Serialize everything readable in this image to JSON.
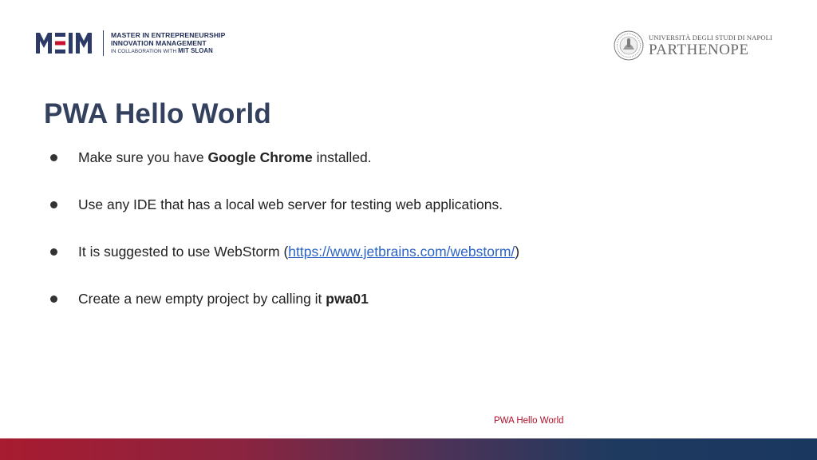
{
  "header": {
    "left_logo": {
      "mark_text": "MEIM",
      "line1": "MASTER IN ENTREPRENEURSHIP",
      "line2": "INNOVATION MANAGEMENT",
      "line3_prefix": "IN COLLABORATION WITH ",
      "line3_strong": "MIT SLOAN"
    },
    "right_logo": {
      "top": "UNIVERSITÀ DEGLI STUDI DI NAPOLI",
      "main": "PARTHENOPE"
    }
  },
  "slide": {
    "title": "PWA Hello World",
    "bullets": [
      {
        "before": "Make sure you have ",
        "strong": "Google Chrome",
        "after": " installed."
      },
      {
        "text": "Use any IDE that has a local web server for testing web applications."
      },
      {
        "before": "It is suggested to use WebStorm (",
        "link": "https://www.jetbrains.com/webstorm/",
        "after": ")"
      },
      {
        "before": "Create a new empty project by calling it ",
        "strong": "pwa01"
      }
    ]
  },
  "footer": {
    "label": "PWA Hello World"
  },
  "colors": {
    "title": "#33415f",
    "link": "#2a63c4",
    "footer_label": "#b0112b",
    "bar_start": "#a81b30",
    "bar_end": "#1a3760",
    "meim_red": "#c8102e",
    "meim_navy": "#2b3a67"
  }
}
